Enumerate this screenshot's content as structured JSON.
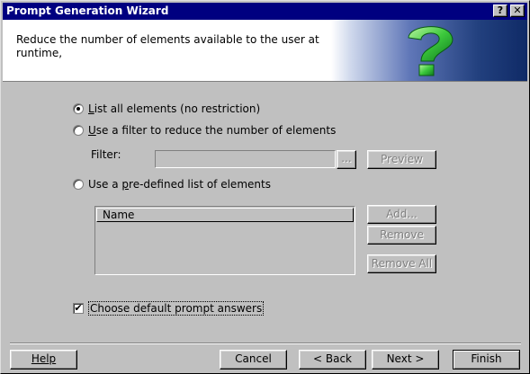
{
  "window": {
    "title": "Prompt Generation Wizard",
    "help_btn": "?",
    "close_btn": "✕"
  },
  "header": {
    "description": "Reduce the number of elements available to the user at runtime,"
  },
  "options": {
    "list_all": {
      "label_prefix": "",
      "label_mnemonic": "L",
      "label_rest": "ist all elements (no restriction)",
      "checked": true
    },
    "use_filter": {
      "label_prefix": "",
      "label_mnemonic": "U",
      "label_rest": "se a filter to reduce the number of elements",
      "checked": false
    },
    "predefined": {
      "label_prefix": "Use a ",
      "label_mnemonic": "p",
      "label_rest": "re-defined list of elements",
      "checked": false
    }
  },
  "filter": {
    "label": "Filter:",
    "value": "",
    "browse_label": "...",
    "preview_label": "Preview"
  },
  "list": {
    "column_header": "Name",
    "items": [],
    "add_label": "Add...",
    "remove_label": "Remove",
    "remove_all_label": "Remove All"
  },
  "default_answers": {
    "label": "Choose default prompt answers",
    "checked": true,
    "check_mark": "✔"
  },
  "footer": {
    "help": "Help",
    "cancel": "Cancel",
    "back": "< Back",
    "next": "Next >",
    "finish": "Finish"
  }
}
